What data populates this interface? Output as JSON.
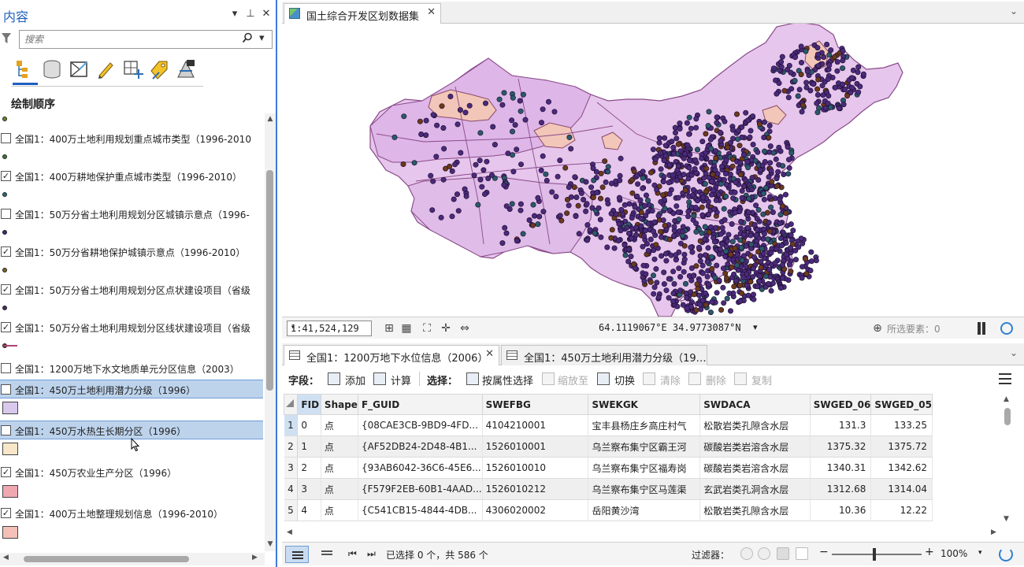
{
  "contents_pane": {
    "title": "内容",
    "search_placeholder": "搜索",
    "drawing_order_label": "绘制顺序",
    "toolbar_icons": [
      "list-by-drawing-order-icon",
      "list-by-source-icon",
      "list-by-selection-icon",
      "list-by-editing-icon",
      "list-by-snapping-icon",
      "list-by-labeling-icon",
      "list-by-perspective-imagery-icon"
    ],
    "layers": [
      {
        "label": "全国1：400万土地利用规划重点城市类型（1996-2010",
        "checked": false,
        "symbol": "dot",
        "color": "#3a7a3a"
      },
      {
        "label": "全国1：400万耕地保护重点城市类型（1996-2010）",
        "checked": true,
        "symbol": "dot",
        "color": "#2a6a7a"
      },
      {
        "label": "全国1：50万分省土地利用规划分区城镇示意点（1996-",
        "checked": false,
        "symbol": "dot",
        "color": "#3a2a7a"
      },
      {
        "label": "全国1：50万分省耕地保护城镇示意点（1996-2010）",
        "checked": true,
        "symbol": "dot",
        "color": "#7a6a1a"
      },
      {
        "label": "全国1：50万分省土地利用规划分区点状建设项目（省级",
        "checked": true,
        "symbol": "dot",
        "color": "#4a2a6a"
      },
      {
        "label": "全国1：50万分省土地利用规划分区线状建设项目（省级",
        "checked": true,
        "symbol": "dot",
        "color": "#6a3a0a"
      },
      {
        "label": "全国1：1200万地下水文地质单元分区信息（2003）",
        "checked": false,
        "symbol": "line",
        "color": "#b0407a"
      },
      {
        "label": "全国1：450万土地利用潜力分级（1996）",
        "checked": false,
        "symbol": "patch",
        "color": "#d8c8ec",
        "selected": true
      },
      {
        "label": "全国1：450万水热生长期分区（1996）",
        "checked": false,
        "symbol": "patch",
        "color": "#f8e6c8",
        "selected": true
      },
      {
        "label": "全国1：450万农业生产分区（1996）",
        "checked": true,
        "symbol": "patch",
        "color": "#f0a8b0"
      },
      {
        "label": "全国1：400万土地整理规划信息（1996-2010）",
        "checked": true,
        "symbol": "patch",
        "color": "#f4c0b8"
      }
    ]
  },
  "map_view": {
    "tab_title": "国土综合开发区划数据集",
    "scale": "1:41,524,129",
    "coordinates": "64.1119067°E 34.9773087°N",
    "selected_features": "所选要素：0",
    "colors": {
      "land": "#e6c6ec",
      "points": "#4a2a7a",
      "boundary": "#8a4a8a"
    }
  },
  "attribute_table": {
    "tabs": [
      {
        "label": "全国1：1200万地下水位信息（2006）",
        "active": true
      },
      {
        "label": "全国1：450万土地利用潜力分级（19…",
        "active": false
      }
    ],
    "toolbar": {
      "field_label": "字段：",
      "add": "添加",
      "calculate": "计算",
      "selection_label": "选择：",
      "select_by_attr": "按属性选择",
      "zoom_to": "缩放至",
      "switch": "切换",
      "clear": "清除",
      "delete": "删除",
      "copy": "复制"
    },
    "columns": [
      "FID",
      "Shape",
      "F_GUID",
      "SWEFBG",
      "SWEKGK",
      "SWDACA",
      "SWGED_06",
      "SWGED_05"
    ],
    "rows": [
      {
        "n": "1",
        "fid": "0",
        "shape": "点",
        "guid": "{08CAE3CB-9BD9-4FD...",
        "swefbg": "4104210001",
        "swekgk": "宝丰县杨庄乡高庄村气",
        "swdaca": "松散岩类孔隙含水层",
        "g06": "131.3",
        "g05": "133.25"
      },
      {
        "n": "2",
        "fid": "1",
        "shape": "点",
        "guid": "{AF52DB24-2D48-4B1...",
        "swefbg": "1526010001",
        "swekgk": "乌兰察布集宁区霸王河",
        "swdaca": "碳酸岩类岩溶含水层",
        "g06": "1375.32",
        "g05": "1375.72"
      },
      {
        "n": "3",
        "fid": "2",
        "shape": "点",
        "guid": "{93AB6042-36C6-45E6...",
        "swefbg": "1526010010",
        "swekgk": "乌兰察布集宁区福寿岗",
        "swdaca": "碳酸岩类岩溶含水层",
        "g06": "1340.31",
        "g05": "1342.62"
      },
      {
        "n": "4",
        "fid": "3",
        "shape": "点",
        "guid": "{F579F2EB-60B1-4AAD...",
        "swefbg": "1526010212",
        "swekgk": "乌兰察布集宁区马莲渠",
        "swdaca": "玄武岩类孔洞含水层",
        "g06": "1312.68",
        "g05": "1314.04"
      },
      {
        "n": "5",
        "fid": "4",
        "shape": "点",
        "guid": "{C541CB15-4844-4DB...",
        "swefbg": "4306020002",
        "swekgk": "岳阳黄沙湾",
        "swdaca": "松散岩类孔隙含水层",
        "g06": "10.36",
        "g05": "12.22"
      }
    ],
    "status": {
      "selection": "已选择 0 个，共 586 个",
      "filters_label": "过滤器：",
      "zoom": "100%"
    }
  }
}
